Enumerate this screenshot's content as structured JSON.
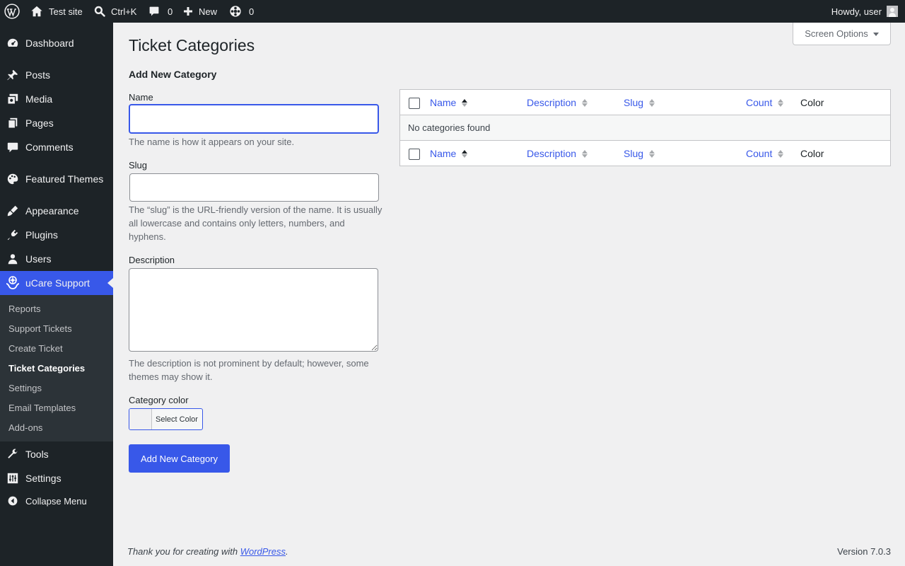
{
  "adminbar": {
    "site_name": "Test site",
    "search_shortcut": "Ctrl+K",
    "comments_count": "0",
    "new_label": "New",
    "updates_count": "0",
    "howdy": "Howdy, user"
  },
  "menu": {
    "items": [
      {
        "label": "Dashboard",
        "icon": "dashboard-icon"
      },
      {
        "label": "Posts",
        "icon": "pushpin-icon"
      },
      {
        "label": "Media",
        "icon": "media-icon"
      },
      {
        "label": "Pages",
        "icon": "pages-icon"
      },
      {
        "label": "Comments",
        "icon": "comment-icon"
      },
      {
        "label": "Featured Themes",
        "icon": "palette-icon"
      },
      {
        "label": "Appearance",
        "icon": "brush-icon"
      },
      {
        "label": "Plugins",
        "icon": "plugin-icon"
      },
      {
        "label": "Users",
        "icon": "user-icon"
      },
      {
        "label": "uCare Support",
        "icon": "support-icon"
      },
      {
        "label": "Tools",
        "icon": "wrench-icon"
      },
      {
        "label": "Settings",
        "icon": "settings-icon"
      }
    ],
    "submenu": [
      "Reports",
      "Support Tickets",
      "Create Ticket",
      "Ticket Categories",
      "Settings",
      "Email Templates",
      "Add-ons"
    ],
    "collapse": "Collapse Menu"
  },
  "screen_options": "Screen Options",
  "page": {
    "title": "Ticket Categories",
    "form_title": "Add New Category",
    "name_label": "Name",
    "name_value": "",
    "name_help": "The name is how it appears on your site.",
    "slug_label": "Slug",
    "slug_value": "",
    "slug_help": "The “slug” is the URL-friendly version of the name. It is usually all lowercase and contains only letters, numbers, and hyphens.",
    "desc_label": "Description",
    "desc_value": "",
    "desc_help": "The description is not prominent by default; however, some themes may show it.",
    "color_label": "Category color",
    "color_button": "Select Color",
    "submit": "Add New Category"
  },
  "table": {
    "columns": [
      "Name",
      "Description",
      "Slug",
      "Count",
      "Color"
    ],
    "empty": "No categories found"
  },
  "footer": {
    "thanks_prefix": "Thank you for creating with ",
    "thanks_link": "WordPress",
    "thanks_suffix": ".",
    "version": "Version 7.0.3"
  },
  "colors": {
    "accent": "#3858e9",
    "adminbar": "#1d2327",
    "background": "#f0f0f1"
  }
}
